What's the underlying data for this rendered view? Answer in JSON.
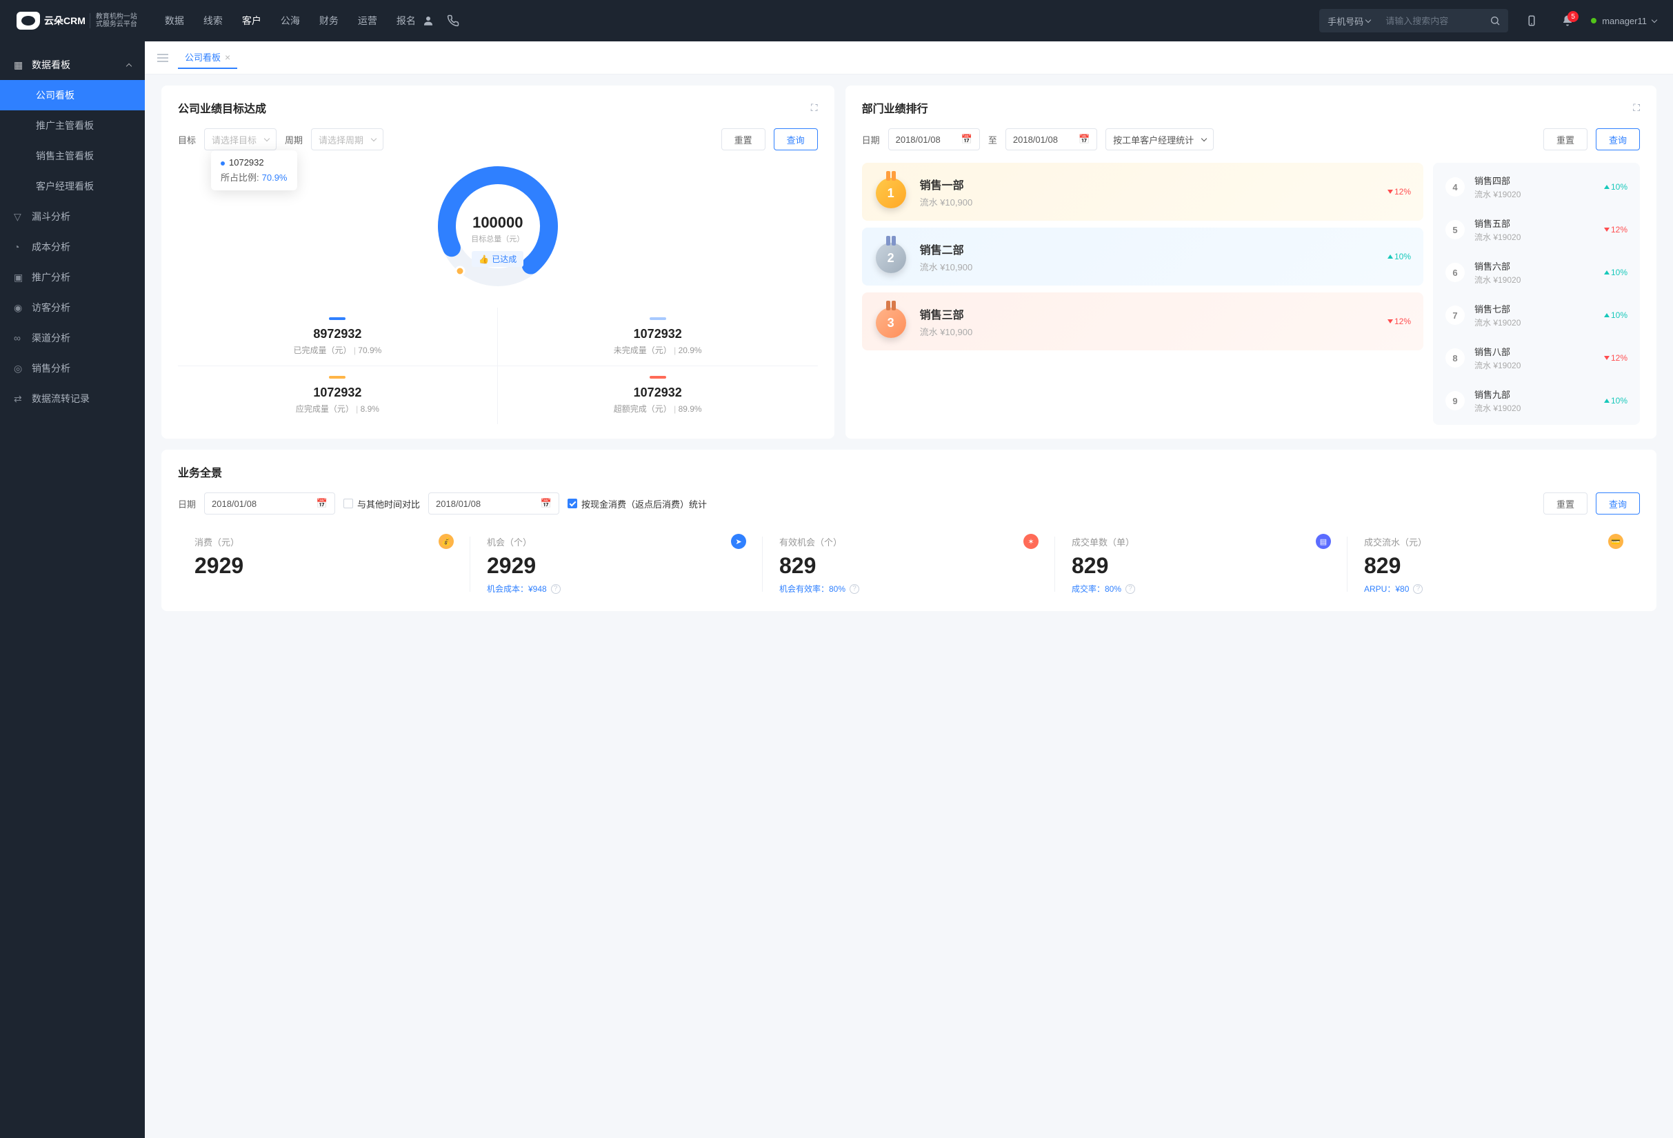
{
  "brand": {
    "name": "云朵CRM",
    "tagline1": "教育机构一站",
    "tagline2": "式服务云平台",
    "url_hint": "www.yunduocrm.com"
  },
  "topnav": [
    "数据",
    "线索",
    "客户",
    "公海",
    "财务",
    "运营",
    "报名"
  ],
  "topnav_active": 2,
  "search": {
    "mode": "手机号码",
    "placeholder": "请输入搜索内容"
  },
  "notif_count": "5",
  "user": "manager11",
  "sidebar": {
    "group": "数据看板",
    "children": [
      "公司看板",
      "推广主管看板",
      "销售主管看板",
      "客户经理看板"
    ],
    "active_child": 0,
    "items": [
      "漏斗分析",
      "成本分析",
      "推广分析",
      "访客分析",
      "渠道分析",
      "销售分析",
      "数据流转记录"
    ]
  },
  "tab": {
    "label": "公司看板"
  },
  "card_goal": {
    "title": "公司业绩目标达成",
    "filters": {
      "target_label": "目标",
      "target_ph": "请选择目标",
      "period_label": "周期",
      "period_ph": "请选择周期",
      "reset": "重置",
      "query": "查询"
    },
    "tooltip": {
      "value": "1072932",
      "ratio_label": "所占比例:",
      "ratio": "70.9%"
    },
    "center": {
      "total": "100000",
      "label": "目标总量（元）",
      "reached": "已达成"
    },
    "stats": [
      {
        "color": "#2f80ff",
        "value": "8972932",
        "label": "已完成量（元）",
        "pct": "70.9%"
      },
      {
        "color": "#a7c9ff",
        "value": "1072932",
        "label": "未完成量（元）",
        "pct": "20.9%"
      },
      {
        "color": "#ffb547",
        "value": "1072932",
        "label": "应完成量（元）",
        "pct": "8.9%"
      },
      {
        "color": "#ff6b57",
        "value": "1072932",
        "label": "超额完成（元）",
        "pct": "89.9%"
      }
    ]
  },
  "card_rank": {
    "title": "部门业绩排行",
    "filters": {
      "date_label": "日期",
      "from": "2018/01/08",
      "to_label": "至",
      "to": "2018/01/08",
      "mode": "按工单客户经理统计",
      "reset": "重置",
      "query": "查询"
    },
    "podium": [
      {
        "rank": "1",
        "name": "销售一部",
        "sub": "流水 ¥10,900",
        "delta": "12%",
        "dir": "down"
      },
      {
        "rank": "2",
        "name": "销售二部",
        "sub": "流水 ¥10,900",
        "delta": "10%",
        "dir": "up"
      },
      {
        "rank": "3",
        "name": "销售三部",
        "sub": "流水 ¥10,900",
        "delta": "12%",
        "dir": "down"
      }
    ],
    "list": [
      {
        "rank": "4",
        "name": "销售四部",
        "sub": "流水 ¥19020",
        "delta": "10%",
        "dir": "up"
      },
      {
        "rank": "5",
        "name": "销售五部",
        "sub": "流水 ¥19020",
        "delta": "12%",
        "dir": "down"
      },
      {
        "rank": "6",
        "name": "销售六部",
        "sub": "流水 ¥19020",
        "delta": "10%",
        "dir": "up"
      },
      {
        "rank": "7",
        "name": "销售七部",
        "sub": "流水 ¥19020",
        "delta": "10%",
        "dir": "up"
      },
      {
        "rank": "8",
        "name": "销售八部",
        "sub": "流水 ¥19020",
        "delta": "12%",
        "dir": "down"
      },
      {
        "rank": "9",
        "name": "销售九部",
        "sub": "流水 ¥19020",
        "delta": "10%",
        "dir": "up"
      }
    ]
  },
  "card_overview": {
    "title": "业务全景",
    "filters": {
      "date_label": "日期",
      "date": "2018/01/08",
      "compare_label": "与其他时间对比",
      "date2": "2018/01/08",
      "check_label": "按现金消费（返点后消费）统计",
      "reset": "重置",
      "query": "查询"
    },
    "kpis": [
      {
        "label": "消费（元）",
        "value": "2929",
        "sub": "",
        "icon_bg": "#ffb547",
        "icon": "💰"
      },
      {
        "label": "机会（个）",
        "value": "2929",
        "sub_label": "机会成本：",
        "sub_val": "¥948",
        "icon_bg": "#2f80ff",
        "icon": "➤"
      },
      {
        "label": "有效机会（个）",
        "value": "829",
        "sub_label": "机会有效率：",
        "sub_val": "80%",
        "icon_bg": "#ff6b57",
        "icon": "✶"
      },
      {
        "label": "成交单数（单）",
        "value": "829",
        "sub_label": "成交率：",
        "sub_val": "80%",
        "icon_bg": "#5b6cff",
        "icon": "▤"
      },
      {
        "label": "成交流水（元）",
        "value": "829",
        "sub_label": "ARPU：",
        "sub_val": "¥80",
        "icon_bg": "#ffb547",
        "icon": "💳"
      }
    ]
  },
  "chart_data": {
    "type": "pie",
    "title": "目标总量（元）",
    "total": 100000,
    "series": [
      {
        "name": "已完成量（元）",
        "value": 8972932,
        "pct": 70.9,
        "color": "#2f80ff"
      },
      {
        "name": "未完成量（元）",
        "value": 1072932,
        "pct": 20.9,
        "color": "#a7c9ff"
      },
      {
        "name": "应完成量（元）",
        "value": 1072932,
        "pct": 8.9,
        "color": "#ffb547"
      },
      {
        "name": "超额完成（元）",
        "value": 1072932,
        "pct": 89.9,
        "color": "#ff6b57"
      }
    ],
    "tooltip": {
      "value": 1072932,
      "ratio": 70.9
    }
  }
}
